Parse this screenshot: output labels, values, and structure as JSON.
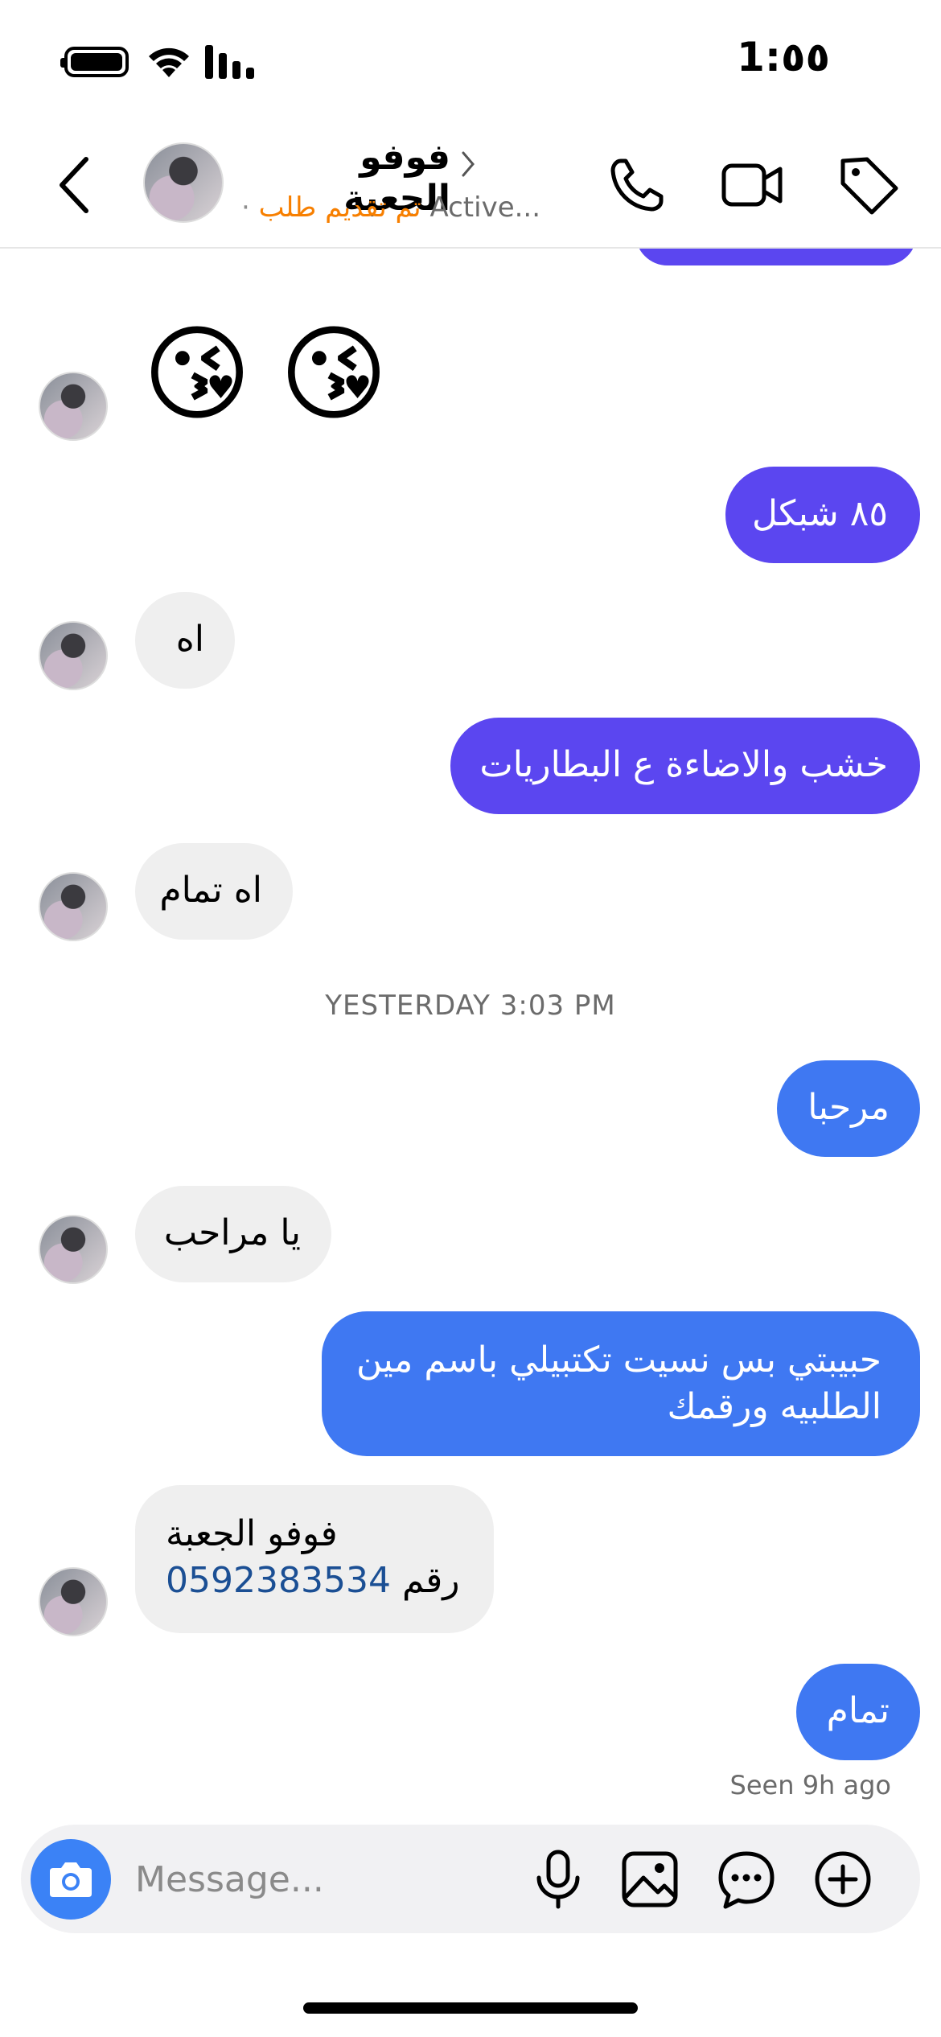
{
  "status_bar": {
    "time": "1:٥٥"
  },
  "header": {
    "contact_name": "فوفو الجعبة",
    "request_status": "تم تقديم طلب",
    "active_status": "Active...",
    "separator": "·",
    "icons": [
      "back-chevron-icon",
      "phone-icon",
      "video-camera-icon",
      "tag-icon"
    ]
  },
  "messages": [
    {
      "from": "them",
      "type": "emoji",
      "text": "😘😘"
    },
    {
      "from": "me",
      "text": "٨٥ شبكل"
    },
    {
      "from": "them",
      "text": "اه"
    },
    {
      "from": "me",
      "text": "خشب والاضاءة ع البطاريات"
    },
    {
      "from": "them",
      "text": "اه تمام"
    },
    {
      "from": "me",
      "text": "مرحبا"
    },
    {
      "from": "them",
      "text": "يا مراحب"
    },
    {
      "from": "me",
      "line1": "حبيبتي بس نسيت تكتبيلي باسم مين",
      "line2": "الطلبيه ورقمك"
    },
    {
      "from": "them",
      "line1": "فوفو الجعبة",
      "word": "رقم",
      "number": "0592383534"
    },
    {
      "from": "me",
      "text": "تمام"
    }
  ],
  "timestamp": "YESTERDAY 3:03 PM",
  "seen": "Seen 9h ago",
  "composer": {
    "placeholder": "Message..."
  },
  "colors": {
    "purple": "#5b46f0",
    "blue": "#3f78f2",
    "incoming": "#efefef",
    "accent_orange": "#f77f00"
  }
}
